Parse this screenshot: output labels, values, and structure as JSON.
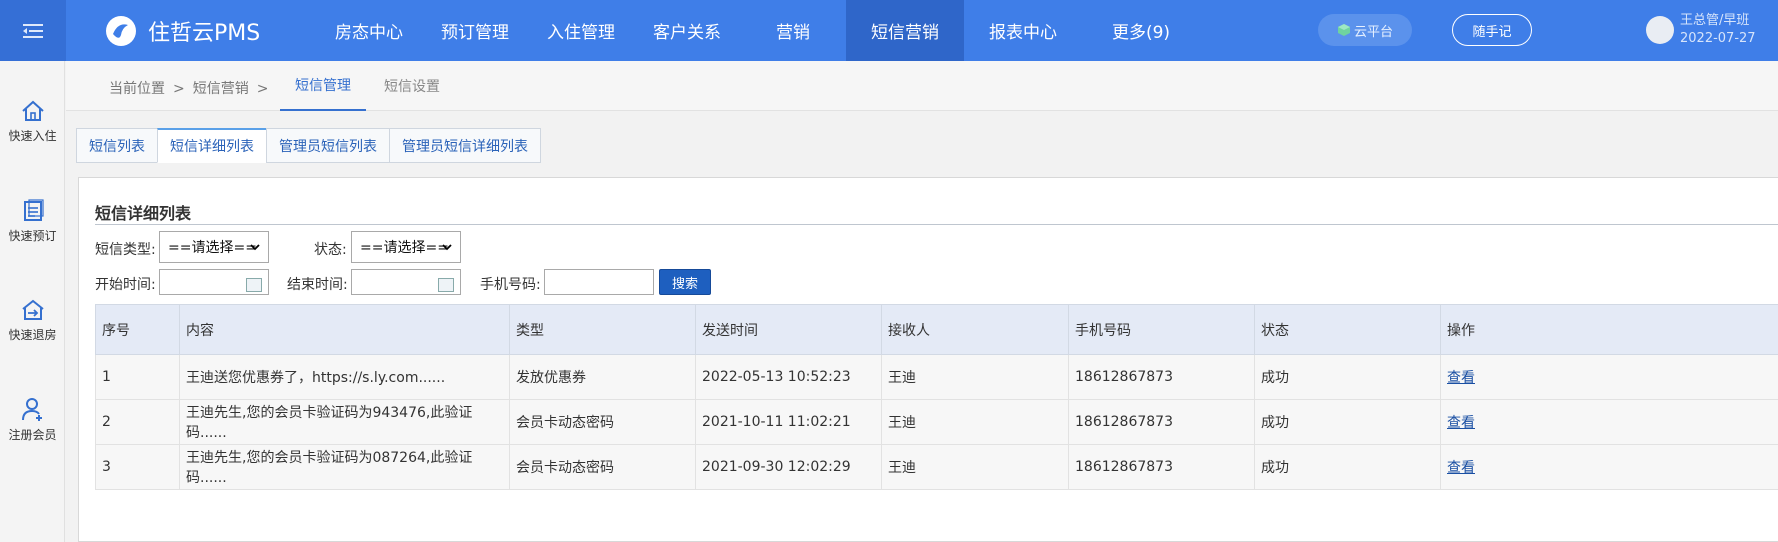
{
  "brand": {
    "name": "住哲云PMS"
  },
  "nav": [
    "房态中心",
    "预订管理",
    "入住管理",
    "客户关系",
    "营销",
    "短信营销",
    "报表中心",
    "更多(9)"
  ],
  "header": {
    "cloud_label": "云平台",
    "note_label": "随手记",
    "user_name": "王总管/早班",
    "user_date": "2022-07-27"
  },
  "sidebar": [
    {
      "label": "快速入住",
      "icon": "home-icon"
    },
    {
      "label": "快速预订",
      "icon": "booking-icon"
    },
    {
      "label": "快速退房",
      "icon": "checkout-icon"
    },
    {
      "label": "注册会员",
      "icon": "add-user-icon"
    }
  ],
  "breadcrumb": {
    "prefix": "当前位置",
    "section": "短信营销",
    "sep": ">"
  },
  "subtabs": [
    "短信管理",
    "短信设置"
  ],
  "tabs": [
    "短信列表",
    "短信详细列表",
    "管理员短信列表",
    "管理员短信详细列表"
  ],
  "panel": {
    "title": "短信详细列表",
    "type_label": "短信类型:",
    "type_value": "==请选择==",
    "status_label": "状态:",
    "status_value": "==请选择==",
    "start_label": "开始时间:",
    "end_label": "结束时间:",
    "phone_label": "手机号码:",
    "search_label": "搜索"
  },
  "table": {
    "headers": [
      "序号",
      "内容",
      "类型",
      "发送时间",
      "接收人",
      "手机号码",
      "状态",
      "操作"
    ],
    "rows": [
      [
        "1",
        "王迪送您优惠券了，https://s.ly.com......",
        "发放优惠券",
        "2022-05-13 10:52:23",
        "王迪",
        "18612867873",
        "成功",
        "查看"
      ],
      [
        "2",
        "王迪先生,您的会员卡验证码为943476,此验证码......",
        "会员卡动态密码",
        "2021-10-11 11:02:21",
        "王迪",
        "18612867873",
        "成功",
        "查看"
      ],
      [
        "3",
        "王迪先生,您的会员卡验证码为087264,此验证码......",
        "会员卡动态密码",
        "2021-09-30 12:02:29",
        "王迪",
        "18612867873",
        "成功",
        "查看"
      ]
    ]
  }
}
